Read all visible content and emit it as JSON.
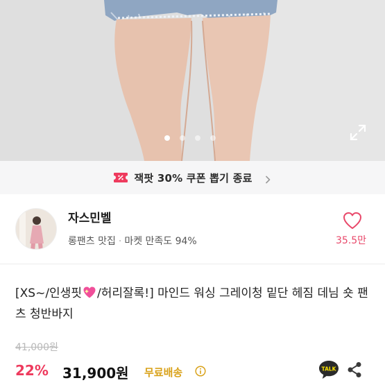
{
  "gallery": {
    "slide_count": 4,
    "active_slide": 1
  },
  "banner": {
    "text": "잭팟 30% 쿠폰 뽑기 종료",
    "accent": "#ee3b5e"
  },
  "seller": {
    "name": "자스민벨",
    "category": "롱팬츠 맛집",
    "separator": "·",
    "satisfaction": "마켓 만족도 94%",
    "likes": "35.5만"
  },
  "product": {
    "title_prefix": "[XS~/인생핏",
    "title_suffix": "/허리잘록!] 마인드 워싱 그레이청 밑단 헤짐 데님 숏 팬츠 청반바지",
    "original_price": "41,000원",
    "discount": "22%",
    "price": "31,900원",
    "shipping": "무료배송"
  },
  "colors": {
    "accent_pink": "#ee3b5e",
    "shipping_gold": "#d9a21a",
    "talk_yellow": "#fae100"
  },
  "icons": {
    "expand": "expand-icon",
    "heart": "heart-icon",
    "coupon": "coupon-icon",
    "chevron": "chevron-right-icon",
    "info": "info-icon",
    "talk": "talk-icon",
    "share": "share-icon"
  }
}
